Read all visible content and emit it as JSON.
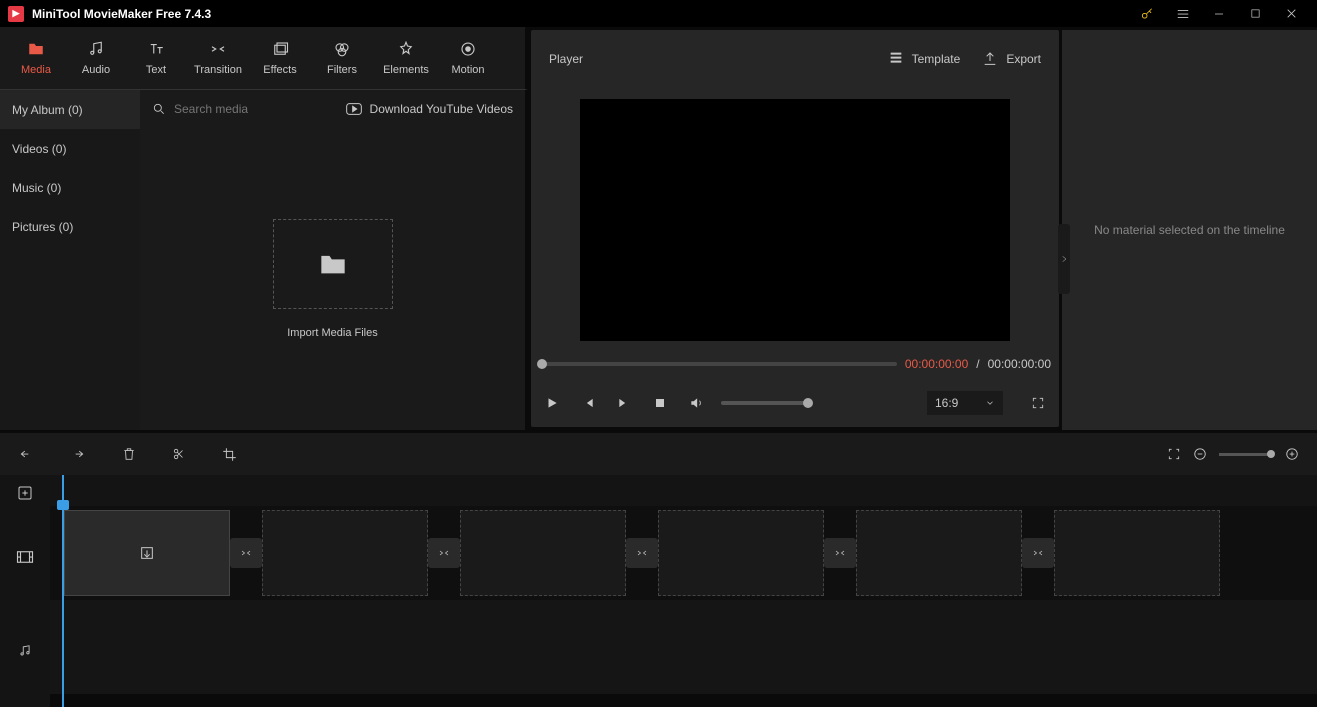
{
  "titlebar": {
    "title": "MiniTool MovieMaker Free 7.4.3"
  },
  "toolTabs": [
    {
      "label": "Media"
    },
    {
      "label": "Audio"
    },
    {
      "label": "Text"
    },
    {
      "label": "Transition"
    },
    {
      "label": "Effects"
    },
    {
      "label": "Filters"
    },
    {
      "label": "Elements"
    },
    {
      "label": "Motion"
    }
  ],
  "sidebar": {
    "items": [
      {
        "label": "My Album (0)"
      },
      {
        "label": "Videos (0)"
      },
      {
        "label": "Music (0)"
      },
      {
        "label": "Pictures (0)"
      }
    ]
  },
  "search": {
    "placeholder": "Search media"
  },
  "youtube": {
    "label": "Download YouTube Videos"
  },
  "import": {
    "label": "Import Media Files"
  },
  "player": {
    "title": "Player",
    "template": "Template",
    "export": "Export",
    "current": "00:00:00:00",
    "sep": " / ",
    "total": "00:00:00:00",
    "aspect": "16:9"
  },
  "rightPanel": {
    "message": "No material selected on the timeline"
  }
}
